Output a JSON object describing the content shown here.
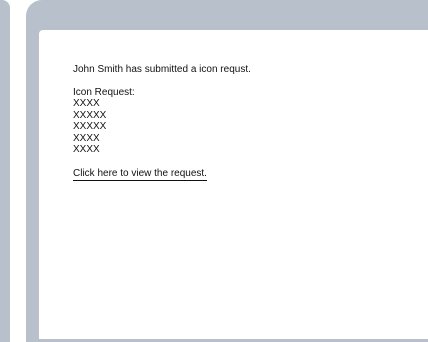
{
  "email": {
    "intro": "John Smith has submitted a icon requst.",
    "list_heading": "Icon Request:",
    "items": [
      "XXXX",
      "XXXXX",
      "XXXXX",
      "XXXX",
      "XXXX"
    ],
    "link_text": "Click here to view the request."
  },
  "colors": {
    "frame": "#b7c0cb",
    "background": "#ffffff",
    "text": "#111111"
  }
}
